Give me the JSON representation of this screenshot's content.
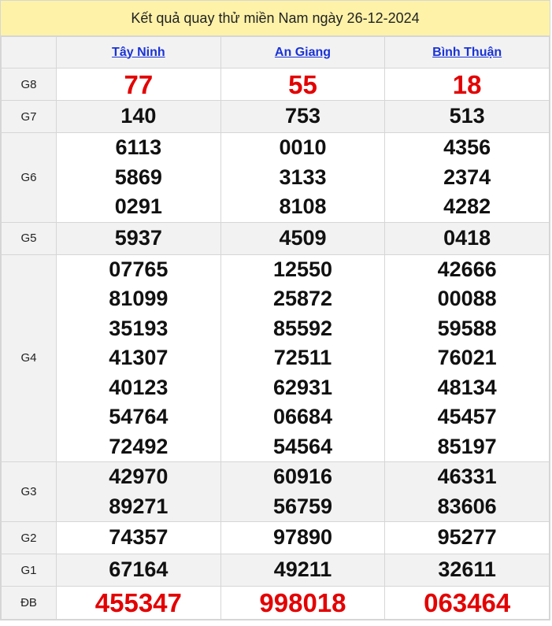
{
  "title": "Kết quả quay thử miền Nam ngày 26-12-2024",
  "provinces": [
    "Tây Ninh",
    "An Giang",
    "Bình Thuận"
  ],
  "rows": [
    {
      "label": "G8",
      "values": [
        [
          "77"
        ],
        [
          "55"
        ],
        [
          "18"
        ]
      ],
      "highlight": true
    },
    {
      "label": "G7",
      "values": [
        [
          "140"
        ],
        [
          "753"
        ],
        [
          "513"
        ]
      ]
    },
    {
      "label": "G6",
      "values": [
        [
          "6113",
          "5869",
          "0291"
        ],
        [
          "0010",
          "3133",
          "8108"
        ],
        [
          "4356",
          "2374",
          "4282"
        ]
      ]
    },
    {
      "label": "G5",
      "values": [
        [
          "5937"
        ],
        [
          "4509"
        ],
        [
          "0418"
        ]
      ]
    },
    {
      "label": "G4",
      "values": [
        [
          "07765",
          "81099",
          "35193",
          "41307",
          "40123",
          "54764",
          "72492"
        ],
        [
          "12550",
          "25872",
          "85592",
          "72511",
          "62931",
          "06684",
          "54564"
        ],
        [
          "42666",
          "00088",
          "59588",
          "76021",
          "48134",
          "45457",
          "85197"
        ]
      ]
    },
    {
      "label": "G3",
      "values": [
        [
          "42970",
          "89271"
        ],
        [
          "60916",
          "56759"
        ],
        [
          "46331",
          "83606"
        ]
      ]
    },
    {
      "label": "G2",
      "values": [
        [
          "74357"
        ],
        [
          "97890"
        ],
        [
          "95277"
        ]
      ]
    },
    {
      "label": "G1",
      "values": [
        [
          "67164"
        ],
        [
          "49211"
        ],
        [
          "32611"
        ]
      ]
    },
    {
      "label": "ĐB",
      "values": [
        [
          "455347"
        ],
        [
          "998018"
        ],
        [
          "063464"
        ]
      ],
      "highlight": true
    }
  ],
  "colors": {
    "title_bg": "#fdf2a8",
    "link": "#1a33d6",
    "highlight": "#e30000",
    "alt_row": "#f2f2f2"
  }
}
